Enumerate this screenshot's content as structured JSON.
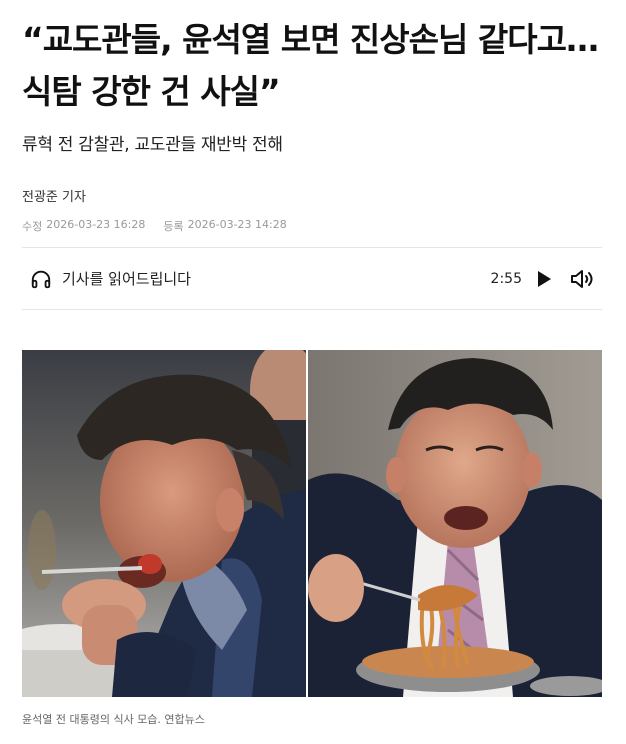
{
  "article": {
    "headline": "“교도관들, 윤석열 보면 진상손님 같다고…식탐 강한 건 사실”",
    "subtitle": "류혁 전 감찰관, 교도관들 재반박 전해",
    "reporter": "전광준 기자",
    "modified_label": "수정",
    "modified_time": "2026-03-23 16:28",
    "published_label": "등록",
    "published_time": "2026-03-23 14:28"
  },
  "audio": {
    "label": "기사를 읽어드립니다",
    "duration": "2:55",
    "icons": [
      "headphones-icon",
      "play-icon",
      "volume-icon"
    ]
  },
  "photo": {
    "caption": "윤석열 전 대통령의 식사 모습. 연합뉴스"
  },
  "colors": {
    "text": "#111111",
    "meta": "#999999",
    "divider": "#e5e5e5"
  }
}
